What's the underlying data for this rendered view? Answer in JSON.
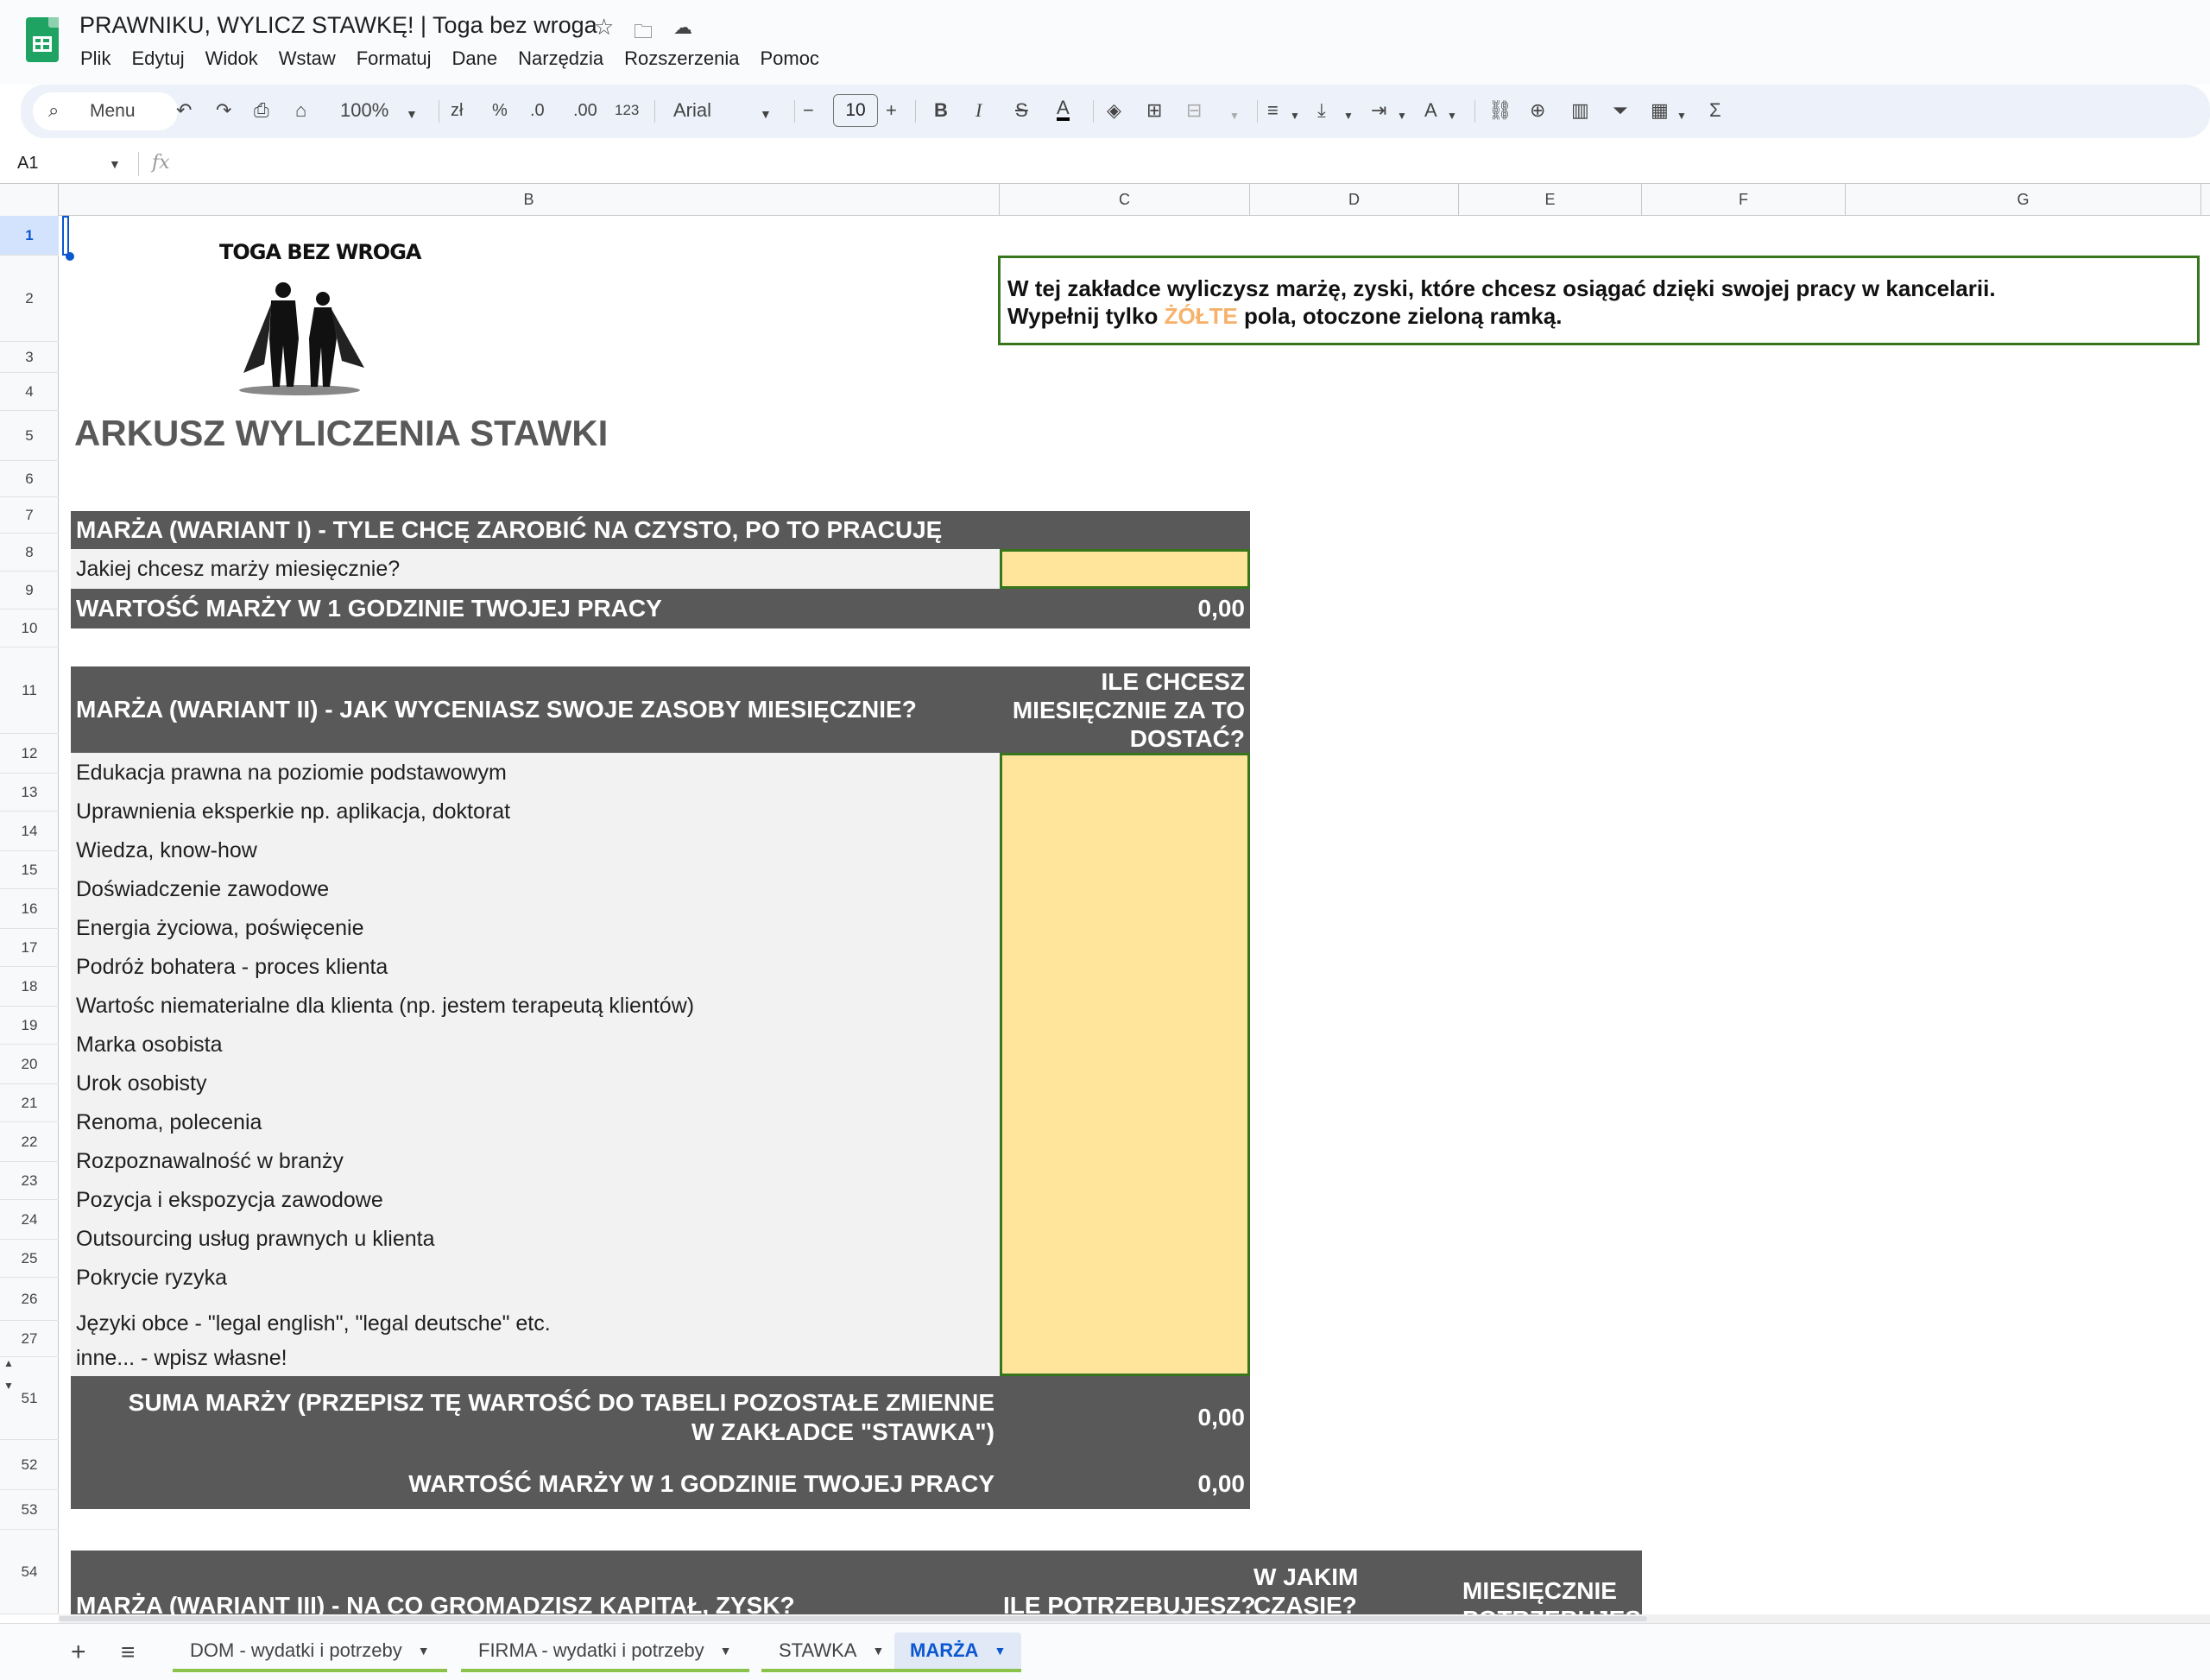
{
  "app": {
    "doc_title": "PRAWNIKU, WYLICZ STAWKĘ! | Toga bez wroga",
    "menu": [
      "Plik",
      "Edytuj",
      "Widok",
      "Wstaw",
      "Formatuj",
      "Dane",
      "Narzędzia",
      "Rozszerzenia",
      "Pomoc"
    ]
  },
  "toolbar": {
    "search_label": "Menu",
    "zoom": "100%",
    "currency": "zł",
    "percent": "%",
    "dec_decrease": ".0",
    "dec_increase": ".00",
    "number_format": "123",
    "font": "Arial",
    "font_size": "10"
  },
  "formula_bar": {
    "name_box": "A1",
    "fx": "fx"
  },
  "columns": [
    "B",
    "C",
    "D",
    "E",
    "F",
    "G"
  ],
  "rows": [
    "1",
    "2",
    "3",
    "4",
    "5",
    "6",
    "7",
    "8",
    "9",
    "10",
    "11",
    "12",
    "13",
    "14",
    "15",
    "16",
    "17",
    "18",
    "19",
    "20",
    "21",
    "22",
    "23",
    "24",
    "25",
    "26",
    "27",
    "51",
    "52",
    "53",
    "54"
  ],
  "logo": {
    "text": "TOGA BEZ WROGA"
  },
  "sheet": {
    "title": "ARKUSZ WYLICZENIA STAWKI",
    "info_line1": "W tej zakładce wyliczysz marżę, zyski, które chcesz osiągać dzięki swojej pracy w kancelarii.",
    "info_line2_pre": "Wypełnij tylko ",
    "info_line2_yellow": "ŻÓŁTE",
    "info_line2_post": " pola, otoczone zieloną ramką.",
    "variant1_header": "MARŻA (WARIANT I) - TYLE CHCĘ ZAROBIĆ NA CZYSTO, PO TO PRACUJĘ",
    "variant1_question": "Jakiej chcesz marży miesięcznie?",
    "variant1_hour_label": "WARTOŚĆ MARŻY W 1 GODZINIE TWOJEJ PRACY",
    "variant1_hour_value": "0,00",
    "variant2_header": "MARŻA (WARIANT II) - JAK WYCENIASZ SWOJE ZASOBY MIESIĘCZNIE?",
    "variant2_col_line1": "ILE CHCESZ",
    "variant2_col_line2": "MIESIĘCZNIE ZA TO",
    "variant2_col_line3": "DOSTAĆ?",
    "variant2_items": [
      "Edukacja prawna na poziomie podstawowym",
      "Uprawnienia eksperkie np. aplikacja, doktorat",
      "Wiedza, know-how",
      "Doświadczenie zawodowe",
      "Energia życiowa, poświęcenie",
      "Podróż bohatera - proces klienta",
      "Wartośc niematerialne dla klienta (np. jestem terapeutą klientów)",
      "Marka osobista",
      "Urok osobisty",
      "Renoma, polecenia",
      "Rozpoznawalność w branży",
      "Pozycja i ekspozycja zawodowe",
      "Outsourcing usług prawnych u klienta",
      "Pokrycie ryzyka",
      "Języki obce - \"legal english\", \"legal deutsche\" etc.",
      "inne... - wpisz własne!"
    ],
    "sum_line1": "SUMA MARŻY (PRZEPISZ TĘ WARTOŚĆ DO TABELI POZOSTAŁE ZMIENNE",
    "sum_line2": "W ZAKŁADCE \"STAWKA\")",
    "sum_value": "0,00",
    "variant2_hour_label": "WARTOŚĆ MARŻY W 1 GODZINIE TWOJEJ PRACY",
    "variant2_hour_value": "0,00",
    "variant3_header": "MARŻA (WARIANT III) - NA CO GROMADZISZ KAPITAŁ, ZYSK?",
    "variant3_col1": "ILE POTRZEBUJESZ?",
    "variant3_col2_line1": "W JAKIM",
    "variant3_col2_line2": "CZASIE?",
    "variant3_col3_line1": "MIESIĘCZNIE",
    "variant3_col3_line2": "POTRZEBUJESZ"
  },
  "tabs": [
    "DOM - wydatki i potrzeby",
    "FIRMA - wydatki i potrzeby",
    "STAWKA",
    "MARŻA"
  ],
  "colors": {
    "dark_header": "#595959",
    "light_row": "#f2f2f2",
    "yellow_input": "#ffe49c",
    "green_border": "#38761d",
    "accent_blue": "#0b57d0"
  }
}
